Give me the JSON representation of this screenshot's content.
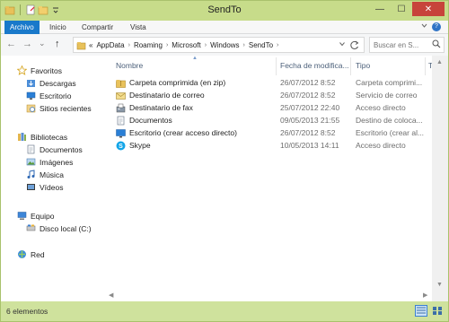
{
  "window": {
    "title": "SendTo",
    "buttons": {
      "minimize": "—",
      "maximize": "☐",
      "close": "✕"
    }
  },
  "ribbon": {
    "tabs": [
      "Archivo",
      "Inicio",
      "Compartir",
      "Vista"
    ],
    "active_tab": "Archivo",
    "toggle_icon": "chevron-down-icon",
    "help": "?"
  },
  "address_bar": {
    "back": "←",
    "forward": "→",
    "recent": "⌄",
    "up": "↑",
    "overflow": "«",
    "crumbs": [
      "AppData",
      "Roaming",
      "Microsoft",
      "Windows",
      "SendTo"
    ],
    "search_placeholder": "Buscar en S..."
  },
  "nav_pane": {
    "favorites": {
      "label": "Favoritos",
      "items": [
        "Descargas",
        "Escritorio",
        "Sitios recientes"
      ]
    },
    "libraries": {
      "label": "Bibliotecas",
      "items": [
        "Documentos",
        "Imágenes",
        "Música",
        "Vídeos"
      ]
    },
    "computer": {
      "label": "Equipo",
      "items": [
        "Disco local (C:)"
      ]
    },
    "network": {
      "label": "Red"
    }
  },
  "file_list": {
    "columns": [
      "Nombre",
      "Fecha de modifica...",
      "Tipo",
      "Tam"
    ],
    "rows": [
      {
        "name": "Carpeta comprimida (en zip)",
        "date": "26/07/2012 8:52",
        "type": "Carpeta comprimi...",
        "icon": "zip-folder-icon"
      },
      {
        "name": "Destinatario de correo",
        "date": "26/07/2012 8:52",
        "type": "Servicio de correo",
        "icon": "mail-recipient-icon"
      },
      {
        "name": "Destinatario de fax",
        "date": "25/07/2012 22:40",
        "type": "Acceso directo",
        "icon": "fax-icon"
      },
      {
        "name": "Documentos",
        "date": "09/05/2013 21:55",
        "type": "Destino de coloca...",
        "icon": "documents-icon"
      },
      {
        "name": "Escritorio (crear acceso directo)",
        "date": "26/07/2012 8:52",
        "type": "Escritorio (crear al...",
        "icon": "desktop-icon"
      },
      {
        "name": "Skype",
        "date": "10/05/2013 14:11",
        "type": "Acceso directo",
        "icon": "skype-icon"
      }
    ]
  },
  "status_bar": {
    "item_count": "6 elementos"
  },
  "colors": {
    "accent": "#1979ca",
    "frame": "#cfe29d",
    "close": "#c7443b"
  }
}
